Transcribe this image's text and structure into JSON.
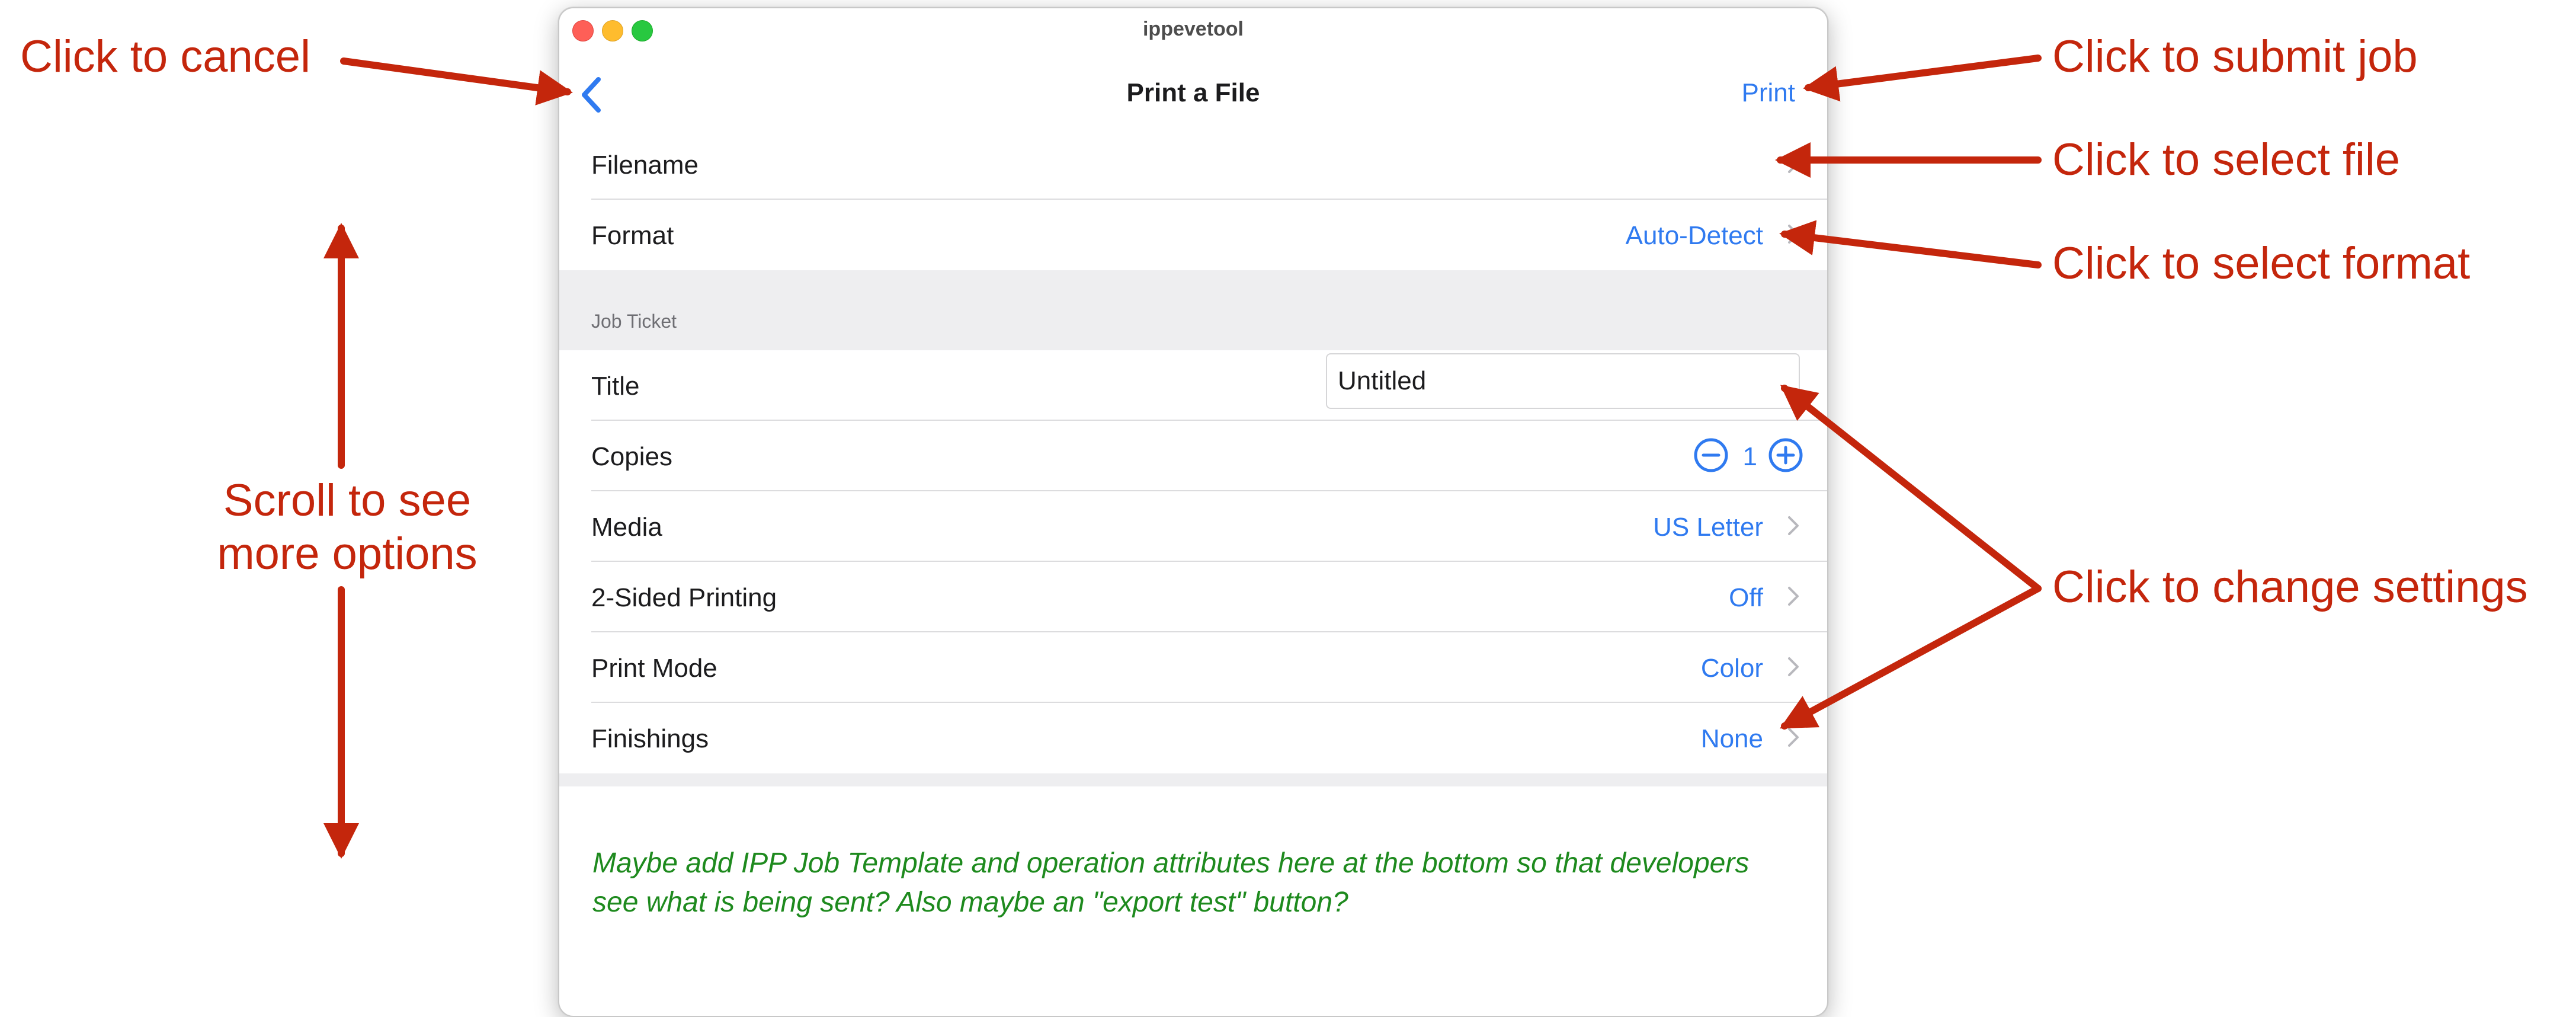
{
  "window": {
    "title": "ippevetool",
    "nav": {
      "title": "Print a File",
      "print_label": "Print",
      "back_icon": "chevron-left-icon"
    },
    "file_section": [
      {
        "label": "Filename",
        "value": ""
      },
      {
        "label": "Format",
        "value": "Auto-Detect"
      }
    ],
    "job_ticket": {
      "header": "Job Ticket",
      "title_label": "Title",
      "title_value": "Untitled",
      "copies_label": "Copies",
      "copies_value": "1",
      "rows": [
        {
          "label": "Media",
          "value": "US Letter"
        },
        {
          "label": "2-Sided Printing",
          "value": "Off"
        },
        {
          "label": "Print Mode",
          "value": "Color"
        },
        {
          "label": "Finishings",
          "value": "None"
        }
      ]
    },
    "note": "Maybe add IPP Job Template and operation attributes here at the bottom so that developers see what is being sent? Also maybe an \"export test\" button?"
  },
  "annotations": {
    "cancel": "Click to cancel",
    "submit": "Click to submit job",
    "select_file": "Click to select file",
    "select_format": "Click to select format",
    "scroll_line1": "Scroll to see",
    "scroll_line2": "more options",
    "change_settings": "Click to change settings"
  },
  "colors": {
    "accent": "#2f7af0",
    "annotation": "#c4260c",
    "note": "#1e8a1e",
    "group_background": "#eeeef0"
  }
}
